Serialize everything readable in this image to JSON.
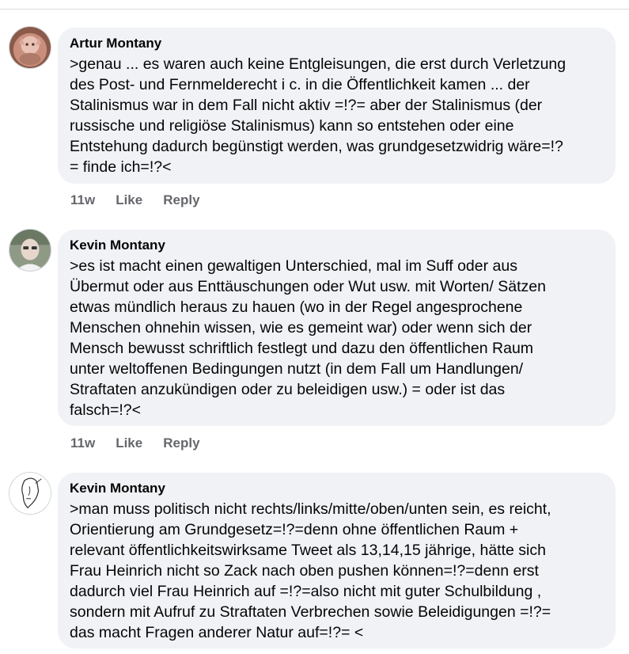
{
  "comments": [
    {
      "author": "Artur Montany",
      "text": ">genau ... es waren auch keine Entgleisungen, die erst durch Verletzung\ndes Post- und Fernmelderecht i c.  in die Öffentlichkeit kamen ... der\nStalinismus war in dem Fall nicht aktiv =!?= aber der Stalinismus (der\nrussische und religiöse Stalinismus) kann so entstehen oder eine\nEntstehung dadurch begünstigt werden, was grundgesetzwidrig wäre=!?\n= finde ich=!?<",
      "time": "11w",
      "like": "Like",
      "reply": "Reply"
    },
    {
      "author": "Kevin Montany",
      "text": ">es ist macht einen gewaltigen Unterschied, mal im Suff oder aus\nÜbermut oder aus Enttäuschungen oder Wut usw. mit Worten/ Sätzen\netwas mündlich heraus zu hauen (wo in der Regel angesprochene\nMenschen ohnehin wissen,  wie es gemeint war) oder wenn sich der\nMensch bewusst schriftlich  festlegt und dazu den öffentlichen Raum\nunter weltoffenen Bedingungen nutzt  (in dem Fall um Handlungen/\nStraftaten  anzukündigen oder zu beleidigen usw.) = oder ist das\nfalsch=!?<",
      "time": "11w",
      "like": "Like",
      "reply": "Reply"
    },
    {
      "author": "Kevin Montany",
      "text": ">man muss politisch nicht rechts/links/mitte/oben/unten sein, es reicht,\nOrientierung am Grundgesetz=!?=denn ohne öffentlichen Raum +\nrelevant öffentlichkeitswirksame Tweet als 13,14,15 jährige,  hätte sich\nFrau Heinrich nicht so Zack nach oben pushen können=!?=denn erst\ndadurch viel Frau Heinrich auf =!?=also nicht mit guter Schulbildung ,\nsondern mit Aufruf zu Straftaten Verbrechen sowie Beleidigungen =!?=\ndas macht Fragen anderer Natur auf=!?= <"
    }
  ],
  "colors": {
    "bubble": "#f0f2f5",
    "text": "#050505",
    "secondary": "#65676b"
  },
  "icons": [
    "avatar-cat-photo",
    "avatar-man-photo",
    "avatar-face-sketch"
  ]
}
